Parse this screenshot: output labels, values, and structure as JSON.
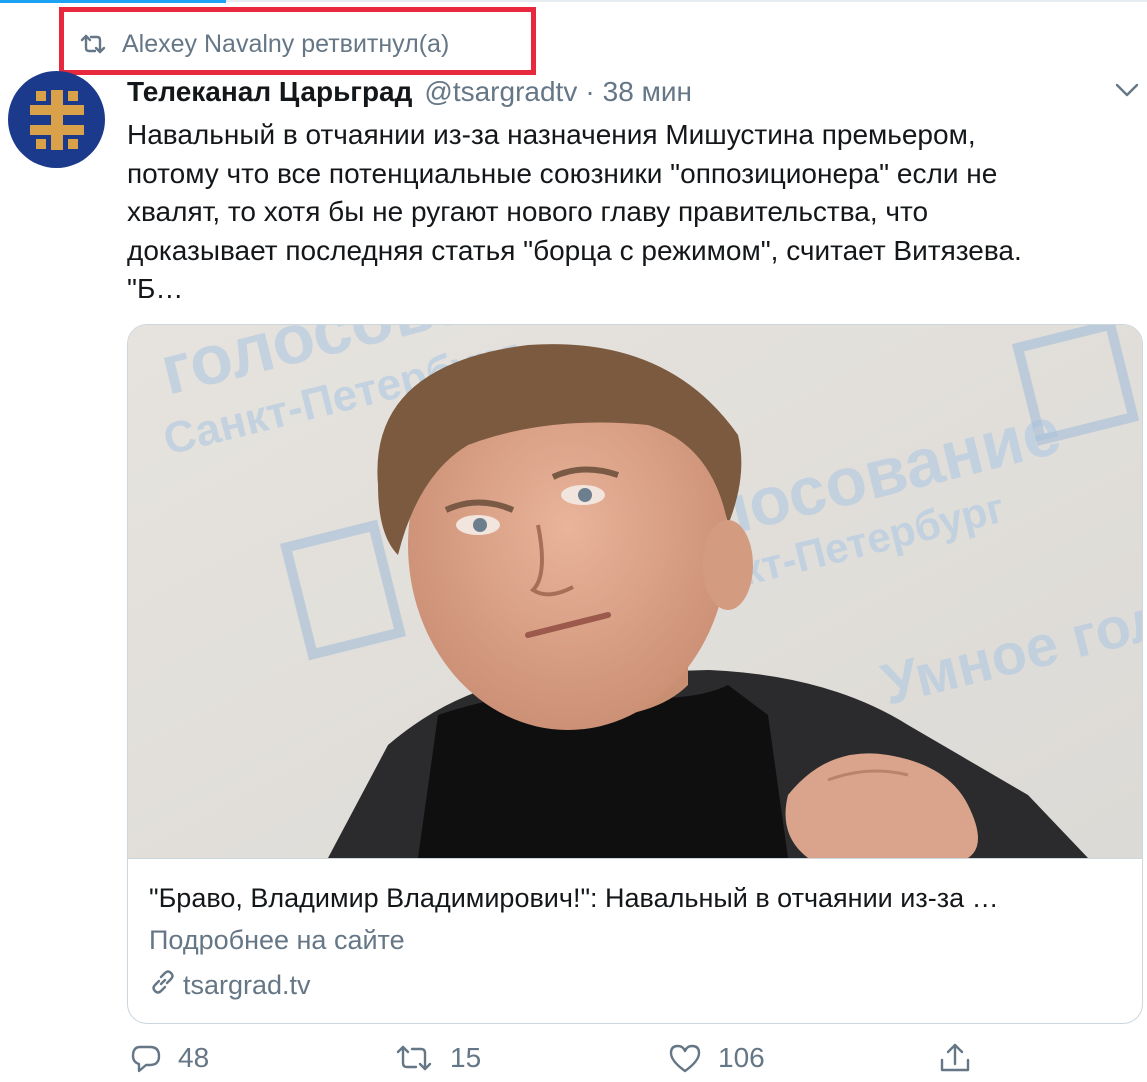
{
  "retweet": {
    "text": "Alexey Navalny ретвитнул(а)"
  },
  "tweet": {
    "author_name": "Телеканал Царьград",
    "author_handle": "@tsargradtv",
    "separator": "·",
    "time": "38 мин",
    "text_lines": [
      "Навальный в отчаянии из-за назначения Мишустина премьером,",
      "потому что все потенциальные союзники \"оппозиционера\" если не",
      "хвалят, то хотя бы не ругают нового главу правительства, что",
      "доказывает последняя статья \"борца с режимом\", считает Витязева.",
      "\"Б…"
    ]
  },
  "card": {
    "title": "\"Браво, Владимир Владимирович!\": Навальный в отчаянии из-за …",
    "subtitle": "Подробнее на сайте",
    "domain": "tsargrad.tv",
    "backdrop_text": [
      "голосование",
      "Санкт-Петербург",
      "Умное голосование"
    ]
  },
  "actions": {
    "reply_count": "48",
    "retweet_count": "15",
    "like_count": "106"
  },
  "icons": {
    "retweet": "retweet-icon",
    "caret": "chevron-down-icon",
    "reply": "reply-icon",
    "like": "heart-icon",
    "share": "share-icon",
    "link": "link-icon"
  },
  "colors": {
    "highlight": "#e8283c",
    "accent": "#1da1f2",
    "secondary_text": "#657786",
    "avatar_bg": "#1b3a8c",
    "avatar_cross": "#d9a24a"
  }
}
